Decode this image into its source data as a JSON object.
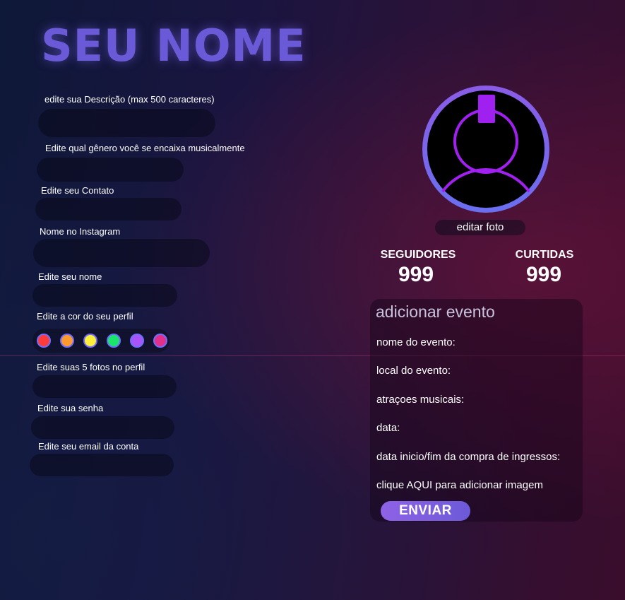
{
  "profile": {
    "name": "SEU NOME",
    "description_label": "edite sua Descrição (max 500 caracteres)",
    "genre_label": "Edite qual gênero você se encaixa musicalmente",
    "contact_label": "Edite seu Contato",
    "instagram_label": "Nome no Instagram",
    "name_label": "Edite seu nome",
    "color_label": "Edite a cor do seu perfil",
    "photos_label": "Edite suas 5 fotos no perfil",
    "password_label": "Edite sua senha",
    "email_label": "Edite seu email da conta",
    "colors": [
      "#ff3b3b",
      "#ff9a2e",
      "#ffef3a",
      "#19e66b",
      "#a855f7",
      "#e0308c"
    ]
  },
  "avatar": {
    "edit_label": "editar foto",
    "accent": "#a020f0"
  },
  "stats": {
    "followers_label": "SEGUIDORES",
    "followers_value": "999",
    "likes_label": "CURTIDAS",
    "likes_value": "999"
  },
  "event": {
    "title": "adicionar evento",
    "name_label": "nome do evento:",
    "place_label": "local do evento:",
    "attractions_label": "atraçoes musicais:",
    "date_label": "data:",
    "tickets_label": "data inicio/fim da compra de ingressos:",
    "image_label": "clique AQUI para adicionar imagem",
    "submit_label": "ENVIAR"
  }
}
